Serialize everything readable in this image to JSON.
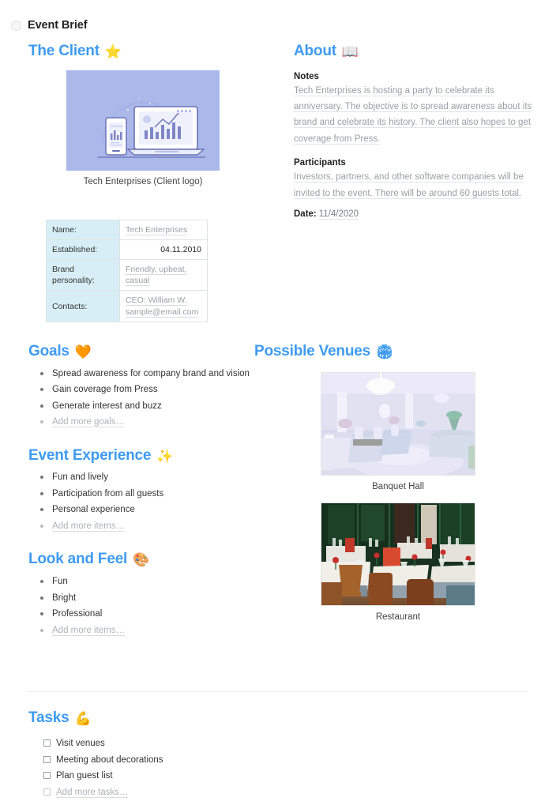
{
  "doc": {
    "title": "Event Brief",
    "bullet_icon": "radio-circle-icon"
  },
  "client": {
    "heading": "The Client",
    "emoji": "⭐",
    "emoji_name": "star-icon",
    "logo_caption": "Tech Enterprises (Client logo)",
    "logo_bg": "#aab8ea",
    "table": [
      {
        "key": "Name:",
        "value": "Tech Enterprises",
        "placeholder": true
      },
      {
        "key": "Established:",
        "value": "04.11.2010",
        "placeholder": false
      },
      {
        "key": "Brand personality:",
        "value": "Friendly, upbeat, casual",
        "placeholder": true
      },
      {
        "key": "Contacts:",
        "value": "CEO: William W. sample@email.com",
        "placeholder": true
      }
    ]
  },
  "about": {
    "heading": "About",
    "emoji": "📖",
    "emoji_name": "open-book-icon",
    "notes_label": "Notes",
    "notes_text": "Tech Enterprises is hosting a party to celebrate its anniversary. The objective is to spread awareness about its brand and celebrate its history. The client also hopes to get coverage from Press.",
    "participants_label": "Participants",
    "participants_text": "Investors, partners, and other software companies will be invited to the event. There will be around 60 guests total.",
    "date_label": "Date:",
    "date_value": "11/4/2020"
  },
  "goals": {
    "heading": "Goals",
    "emoji": "🧡",
    "emoji_name": "orange-heart-icon",
    "items": [
      "Spread awareness for company brand and vision",
      "Gain coverage from Press",
      "Generate interest and buzz"
    ],
    "placeholder": "Add more goals…"
  },
  "experience": {
    "heading": "Event Experience",
    "emoji": "✨",
    "emoji_name": "sparkles-icon",
    "items": [
      "Fun and lively",
      "Participation from all guests",
      "Personal experience"
    ],
    "placeholder": "Add more items…"
  },
  "look": {
    "heading": "Look and Feel",
    "emoji": "🎨",
    "emoji_name": "artist-palette-icon",
    "items": [
      "Fun",
      "Bright",
      "Professional"
    ],
    "placeholder": "Add more items…"
  },
  "venues": {
    "heading": "Possible Venues",
    "emoji": "🏟",
    "emoji_name": "stadium-icon",
    "items": [
      {
        "caption": "Banquet Hall",
        "alt": "banquet-hall-photo"
      },
      {
        "caption": "Restaurant",
        "alt": "restaurant-photo"
      }
    ]
  },
  "tasks": {
    "heading": "Tasks",
    "emoji": "💪",
    "emoji_name": "flexed-biceps-icon",
    "items": [
      "Visit venues",
      "Meeting about decorations",
      "Plan guest list"
    ],
    "placeholder": "Add more tasks…"
  },
  "colors": {
    "heading_blue": "#3e9bf0",
    "table_key_bg": "#d8eef6",
    "placeholder_gray": "#9aa0a6"
  }
}
